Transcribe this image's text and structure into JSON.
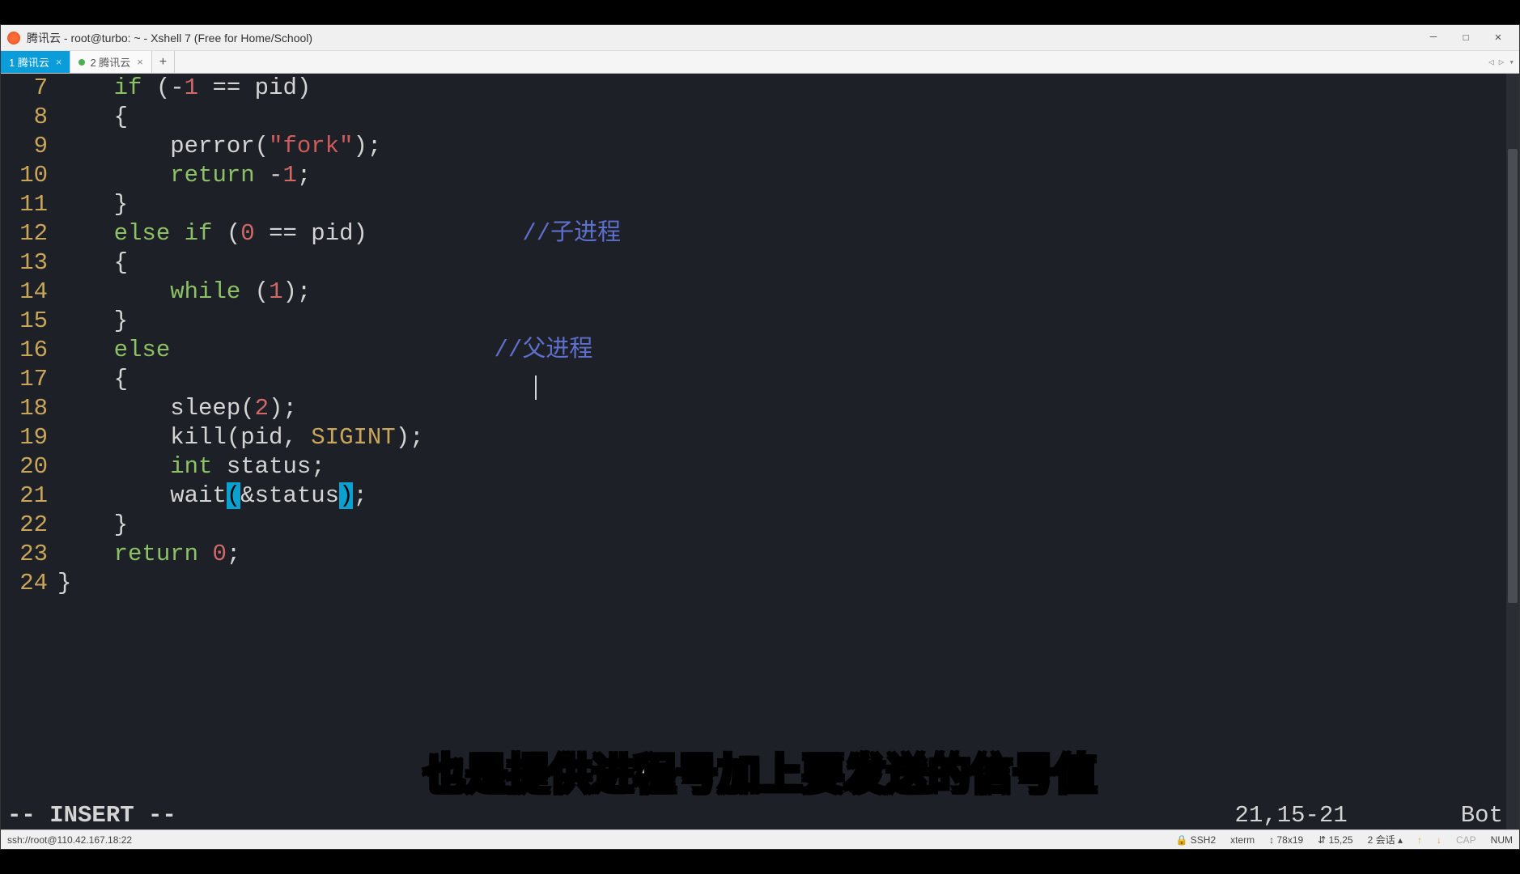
{
  "window": {
    "title": "腾讯云 - root@turbo: ~ - Xshell 7 (Free for Home/School)"
  },
  "tabs": [
    {
      "label": "1 腾讯云",
      "active": true
    },
    {
      "label": "2 腾讯云",
      "active": false
    }
  ],
  "code": {
    "line7": {
      "n": "7",
      "a": "    ",
      "kw": "if",
      "b": " (-",
      "num": "1",
      "c": " == pid)"
    },
    "line8": {
      "n": "8",
      "a": "    {"
    },
    "line9": {
      "n": "9",
      "a": "        perror(",
      "str": "\"fork\"",
      "b": ");"
    },
    "line10": {
      "n": "10",
      "a": "        ",
      "kw": "return",
      "b": " -",
      "num": "1",
      "c": ";"
    },
    "line11": {
      "n": "11",
      "a": "    }"
    },
    "line12": {
      "n": "12",
      "a": "    ",
      "kw1": "else",
      "sp1": " ",
      "kw2": "if",
      "b": " (",
      "num": "0",
      "c": " == pid)           ",
      "cmt": "//子进程"
    },
    "line13": {
      "n": "13",
      "a": "    {"
    },
    "line14": {
      "n": "14",
      "a": "        ",
      "kw": "while",
      "b": " (",
      "num": "1",
      "c": ");"
    },
    "line15": {
      "n": "15",
      "a": "    }"
    },
    "line16": {
      "n": "16",
      "a": "    ",
      "kw": "else",
      "b": "                       ",
      "cmt": "//父进程"
    },
    "line17": {
      "n": "17",
      "a": "    {"
    },
    "line18": {
      "n": "18",
      "a": "        sleep(",
      "num": "2",
      "b": ");"
    },
    "line19": {
      "n": "19",
      "a": "        kill(pid, ",
      "id": "SIGINT",
      "b": ");"
    },
    "line20": {
      "n": "20",
      "a": "        ",
      "kw": "int",
      "b": " status;"
    },
    "line21": {
      "n": "21",
      "a": "        wait",
      "p1": "(",
      "b": "&status",
      "p2": ")",
      "c": ";"
    },
    "line22": {
      "n": "22",
      "a": "    }"
    },
    "line23": {
      "n": "23",
      "a": "    ",
      "kw": "return",
      "b": " ",
      "num": "0",
      "c": ";"
    },
    "line24": {
      "n": "24",
      "a": "}"
    }
  },
  "vim": {
    "mode": "-- INSERT --",
    "pos": "21,15-21",
    "scroll": "Bot"
  },
  "status": {
    "conn": "ssh://root@110.42.167.18:22",
    "ssh": "SSH2",
    "term": "xterm",
    "size": "78x19",
    "cursor": "15,25",
    "sessions": "2 会话",
    "cap": "CAP",
    "num": "NUM"
  },
  "subtitle": "也是提供进程号加上要发送的信号值"
}
